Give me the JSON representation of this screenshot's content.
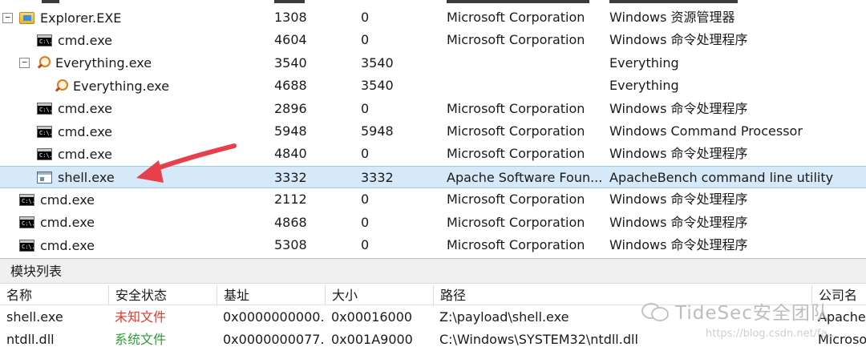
{
  "process_rows": [
    {
      "name": "Explorer.EXE",
      "pid": "1308",
      "ppid": "0",
      "company": "Microsoft Corporation",
      "description": "Windows 资源管理器",
      "icon": "folder-icon",
      "toggle": "−"
    },
    {
      "name": "cmd.exe",
      "pid": "4604",
      "ppid": "0",
      "company": "Microsoft Corporation",
      "description": "Windows 命令处理程序",
      "icon": "cmd-icon"
    },
    {
      "name": "Everything.exe",
      "pid": "3540",
      "ppid": "3540",
      "company": "",
      "description": "Everything",
      "icon": "search-icon",
      "toggle": "−"
    },
    {
      "name": "Everything.exe",
      "pid": "4688",
      "ppid": "3540",
      "company": "",
      "description": "Everything",
      "icon": "search-icon"
    },
    {
      "name": "cmd.exe",
      "pid": "2896",
      "ppid": "0",
      "company": "Microsoft Corporation",
      "description": "Windows 命令处理程序",
      "icon": "cmd-icon"
    },
    {
      "name": "cmd.exe",
      "pid": "5948",
      "ppid": "5948",
      "company": "Microsoft Corporation",
      "description": "Windows Command Processor",
      "icon": "cmd-icon"
    },
    {
      "name": "cmd.exe",
      "pid": "4840",
      "ppid": "0",
      "company": "Microsoft Corporation",
      "description": "Windows 命令处理程序",
      "icon": "cmd-icon"
    },
    {
      "name": "shell.exe",
      "pid": "3332",
      "ppid": "3332",
      "company": "Apache Software Foun...",
      "description": "ApacheBench command line utility",
      "icon": "window-icon",
      "selected": true
    },
    {
      "name": "cmd.exe",
      "pid": "2112",
      "ppid": "0",
      "company": "Microsoft Corporation",
      "description": "Windows 命令处理程序",
      "icon": "cmd-icon"
    },
    {
      "name": "cmd.exe",
      "pid": "4868",
      "ppid": "0",
      "company": "Microsoft Corporation",
      "description": "Windows 命令处理程序",
      "icon": "cmd-icon"
    },
    {
      "name": "cmd.exe",
      "pid": "5308",
      "ppid": "0",
      "company": "Microsoft Corporation",
      "description": "Windows 命令处理程序",
      "icon": "cmd-icon"
    }
  ],
  "cmd_icon_text": "C:\\.",
  "modules": {
    "title": "模块列表",
    "columns": [
      "名称",
      "安全状态",
      "基址",
      "大小",
      "路径",
      "公司名"
    ],
    "rows": [
      {
        "name": "shell.exe",
        "status": "未知文件",
        "status_color": "#e23b2e",
        "base": "0x0000000000...",
        "size": "0x00016000",
        "path": "Z:\\payload\\shell.exe",
        "company": "Apache"
      },
      {
        "name": "ntdll.dll",
        "status": "系统文件",
        "status_color": "#2f9c3a",
        "base": "0x0000000077...",
        "size": "0x001A9000",
        "path": "C:\\Windows\\SYSTEM32\\ntdll.dll",
        "company": "Microso"
      }
    ]
  },
  "annotation": {
    "arrow_color": "#e8404a"
  },
  "watermark": {
    "text": "TideSec安全团队",
    "url": "https://blog.csdn.net/fa..."
  }
}
